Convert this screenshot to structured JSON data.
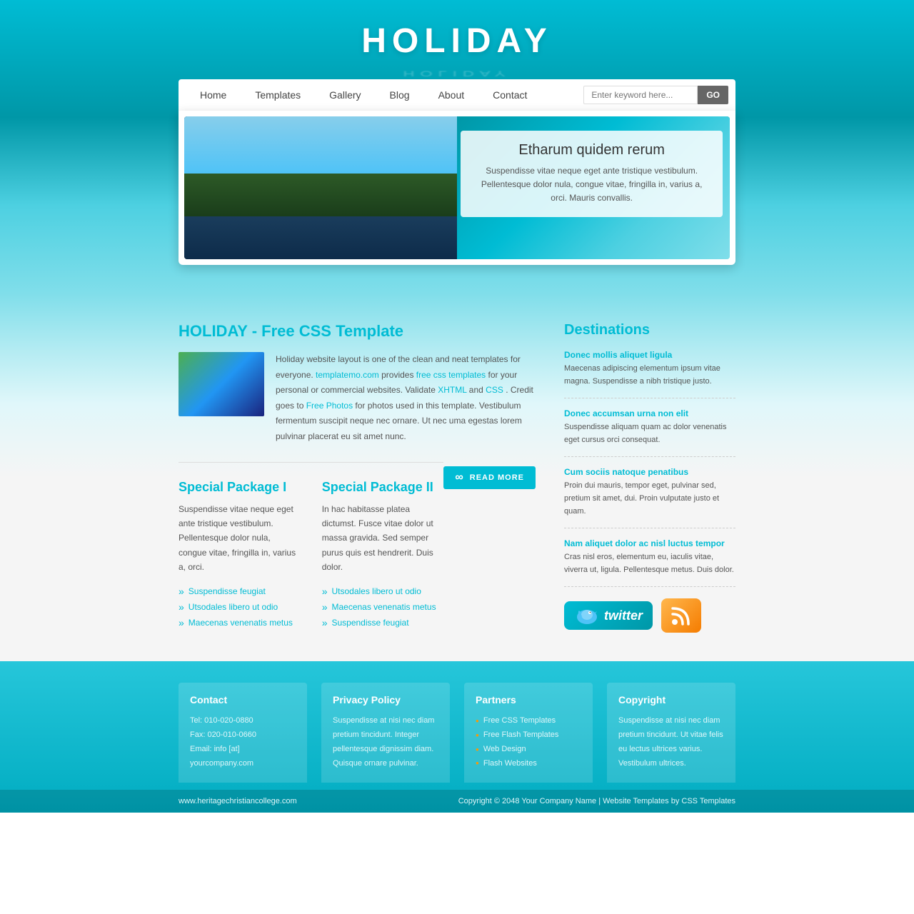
{
  "site": {
    "title": "HOLIDAY",
    "tagline_reflection": "HOLIDAY"
  },
  "nav": {
    "home": "Home",
    "templates": "Templates",
    "gallery": "Gallery",
    "blog": "Blog",
    "about": "About",
    "contact": "Contact",
    "search_placeholder": "Enter keyword here...",
    "search_button": "GO"
  },
  "hero": {
    "heading": "Etharum quidem rerum",
    "text": "Suspendisse vitae neque eget ante tristique vestibulum. Pellentesque dolor nula, congue vitae, fringilla in, varius a, orci. Mauris convallis."
  },
  "main": {
    "section_title": "HOLIDAY - Free CSS Template",
    "about_p1": "Holiday website layout is one of the clean and neat templates for everyone.",
    "about_link1": "templatemo.com",
    "about_p2": " provides ",
    "about_link2": "free css templates",
    "about_p3": " for your personal or commercial websites. Validate ",
    "about_link3": "XHTML",
    "about_p4": " and ",
    "about_link4": "CSS",
    "about_p5": ". Credit goes to ",
    "about_link5": "Free Photos",
    "about_p6": " for photos used in this template. Vestibulum fermentum suscipit neque nec ornare. Ut nec uma egestas lorem pulvinar placerat eu sit amet nunc.",
    "read_more": "READ MORE",
    "package1_title": "Special Package I",
    "package1_text": "Suspendisse vitae neque eget ante tristique vestibulum. Pellentesque dolor nula, congue vitae, fringilla in, varius a, orci.",
    "package1_items": [
      "Suspendisse feugiat",
      "Utsodales libero ut odio",
      "Maecenas venenatis metus"
    ],
    "package2_title": "Special Package II",
    "package2_text": "In hac habitasse platea dictumst. Fusce vitae dolor ut massa gravida. Sed semper purus quis est hendrerit. Duis dolor.",
    "package2_items": [
      "Utsodales libero ut odio",
      "Maecenas venenatis metus",
      "Suspendisse feugiat"
    ]
  },
  "sidebar": {
    "title": "Destinations",
    "items": [
      {
        "title": "Donec mollis aliquet ligula",
        "text": "Maecenas adipiscing elementum ipsum vitae magna. Suspendisse a nibh tristique justo."
      },
      {
        "title": "Donec accumsan urna non elit",
        "text": "Suspendisse aliquam quam ac dolor venenatis eget cursus orci consequat."
      },
      {
        "title": "Cum sociis natoque penatibus",
        "text": "Proin dui mauris, tempor eget, pulvinar sed, pretium sit amet, dui. Proin vulputate justo et quam."
      },
      {
        "title": "Nam aliquet dolor ac nisl luctus tempor",
        "text": "Cras nisl eros, elementum eu, iaculis vitae, viverra ut, ligula. Pellentesque metus. Duis dolor."
      }
    ],
    "twitter_label": "twitter",
    "rss_symbol": "⊕"
  },
  "footer": {
    "col1_title": "Contact",
    "col1_tel": "Tel: 010-020-0880",
    "col1_fax": "Fax: 020-010-0660",
    "col1_email": "Email: info [at] yourcompany.com",
    "col2_title": "Privacy Policy",
    "col2_text": "Suspendisse at nisi nec diam pretium tincidunt. Integer pellentesque dignissim diam. Quisque ornare pulvinar.",
    "col3_title": "Partners",
    "col3_links": [
      "Free CSS Templates",
      "Free Flash Templates",
      "Web Design",
      "Flash Websites"
    ],
    "col4_title": "Copyright",
    "col4_text": "Suspendisse at nisi nec diam pretium tincidunt. Ut vitae felis eu lectus ultrices varius. Vestibulum ultrices.",
    "bottom_left": "www.heritagechristiancollege.com",
    "copyright": "Copyright © 2048",
    "company_link": "Your Company Name",
    "separator": "|",
    "template_link": "Website Templates",
    "by": "by",
    "css_link": "CSS Templates"
  }
}
